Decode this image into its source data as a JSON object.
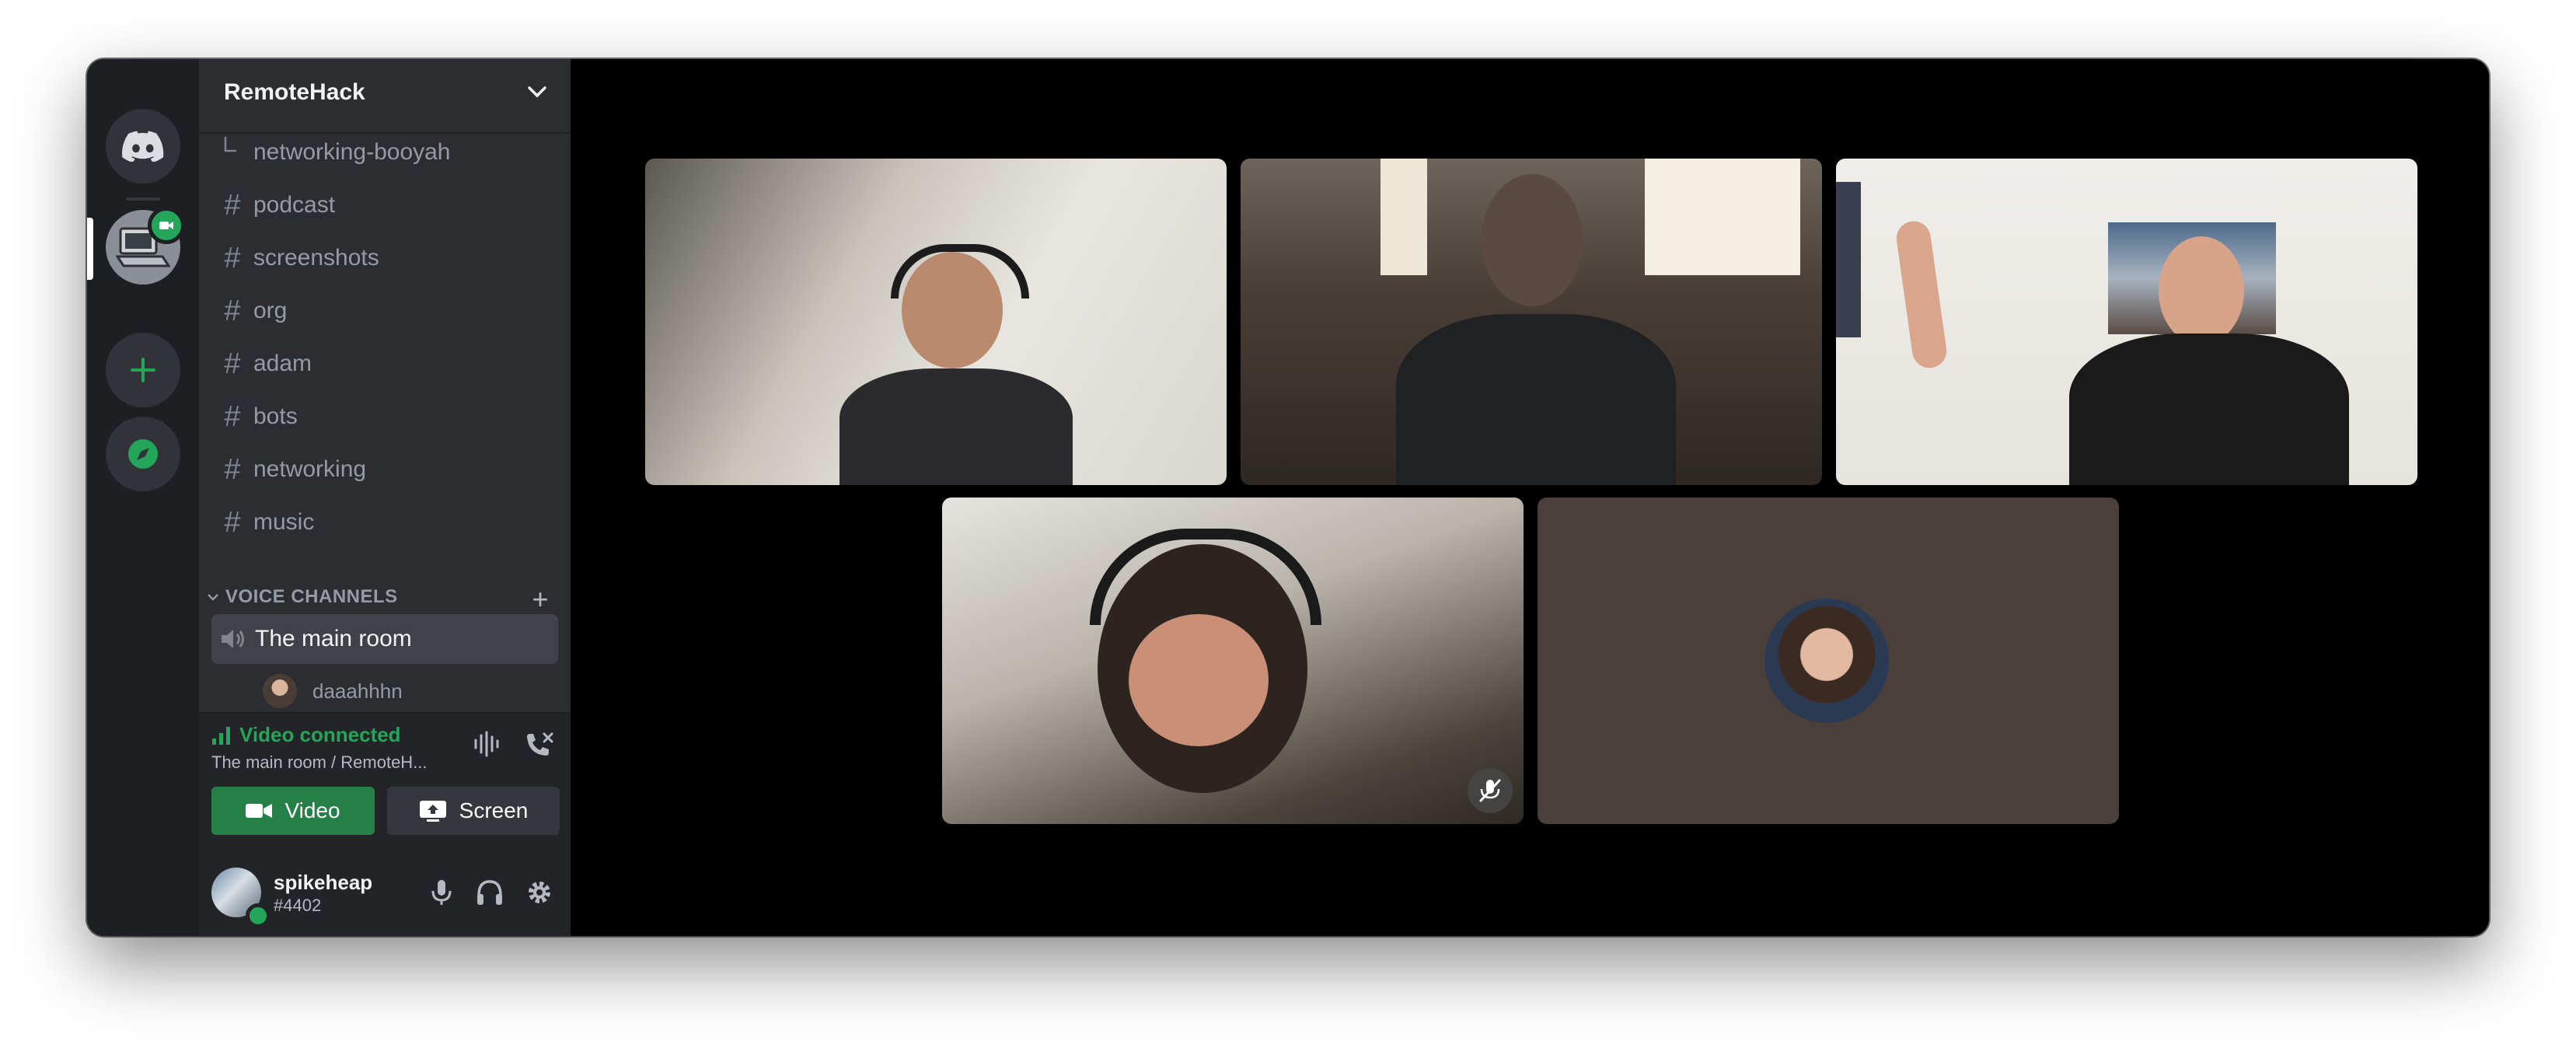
{
  "server": {
    "name": "RemoteHack"
  },
  "channels": [
    {
      "name": "networking-booyah",
      "kind": "thread"
    },
    {
      "name": "podcast",
      "kind": "text"
    },
    {
      "name": "screenshots",
      "kind": "text"
    },
    {
      "name": "org",
      "kind": "text"
    },
    {
      "name": "adam",
      "kind": "text"
    },
    {
      "name": "bots",
      "kind": "text"
    },
    {
      "name": "networking",
      "kind": "text"
    },
    {
      "name": "music",
      "kind": "text"
    }
  ],
  "voice": {
    "category": "VOICE CHANNELS",
    "channel": "The main room",
    "user": "daaahhhn"
  },
  "voice_panel": {
    "status": "Video connected",
    "location": "The main room / RemoteH...",
    "video_label": "Video",
    "screen_label": "Screen"
  },
  "user": {
    "name": "spikeheap",
    "tag": "#4402"
  },
  "colors": {
    "accent_green": "#23a55a",
    "video_button": "#248046",
    "sidebar_bg": "#2b2d31",
    "rail_bg": "#1e1f22"
  },
  "icons": [
    "discord-home-icon",
    "server-remotehack-icon",
    "add-server-icon",
    "explore-icon",
    "chevron-down-icon",
    "hash-icon",
    "speaker-icon",
    "signal-icon",
    "soundwave-icon",
    "disconnect-icon",
    "camera-icon",
    "screen-share-icon",
    "microphone-icon",
    "headphones-icon",
    "gear-icon",
    "mic-muted-icon"
  ]
}
